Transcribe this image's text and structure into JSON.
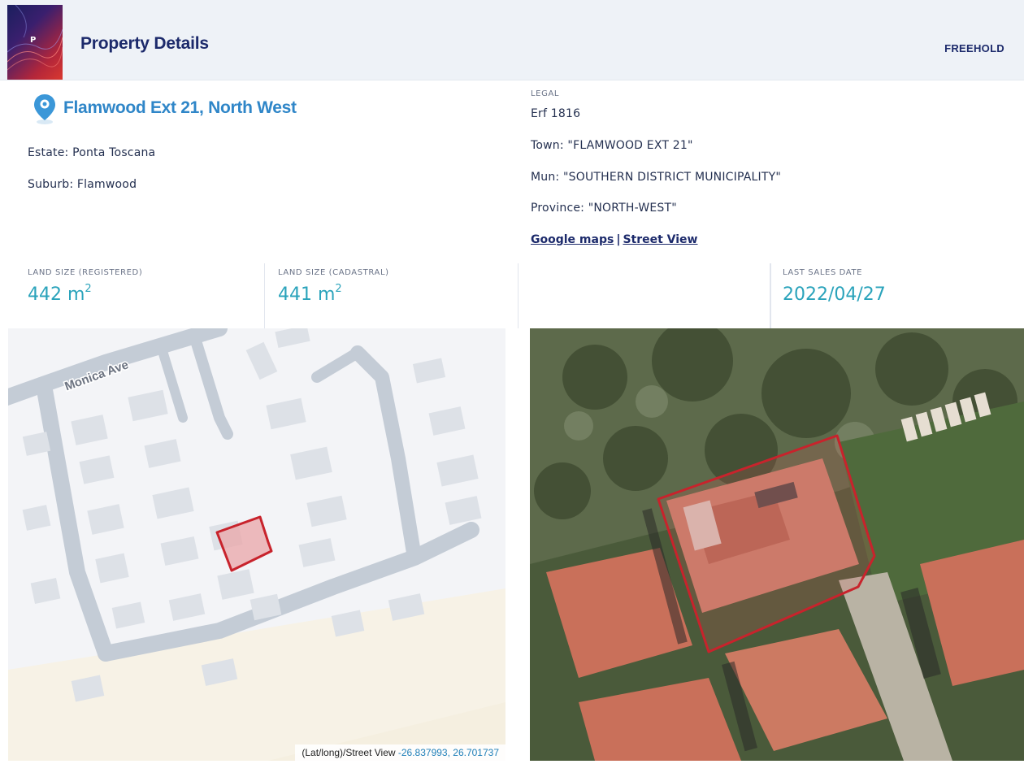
{
  "header": {
    "logo_letter": "P",
    "title": "Property Details",
    "tenure": "FREEHOLD"
  },
  "location": {
    "icon": "map-pin-icon",
    "title": "Flamwood Ext 21, North West",
    "estate": "Estate: Ponta Toscana",
    "suburb": "Suburb: Flamwood"
  },
  "legal": {
    "label": "LEGAL",
    "erf": "Erf 1816",
    "town": "Town: \"FLAMWOOD EXT 21\"",
    "municipality": "Mun: \"SOUTHERN DISTRICT MUNICIPALITY\"",
    "province": "Province: \"NORTH-WEST\"",
    "google_maps_link": "Google maps",
    "separator": "|",
    "street_view_link": "Street View"
  },
  "stats": {
    "land_size_registered": {
      "label": "LAND SIZE (REGISTERED)",
      "value": "442 m",
      "unit_exp": "2"
    },
    "land_size_cadastral": {
      "label": "LAND SIZE (CADASTRAL)",
      "value": "441 m",
      "unit_exp": "2"
    },
    "last_sales_date": {
      "label": "LAST SALES DATE",
      "value": "2022/04/27"
    }
  },
  "map": {
    "street_label": "Monica Ave",
    "coords_prefix": "(Lat/long)/Street View ",
    "coords_value": "-26.837993, 26.701737"
  },
  "colors": {
    "brand_navy": "#1c2a6b",
    "accent_blue": "#2f86c8",
    "stat_teal": "#2aa3bb",
    "parcel_red": "#c8232c"
  }
}
